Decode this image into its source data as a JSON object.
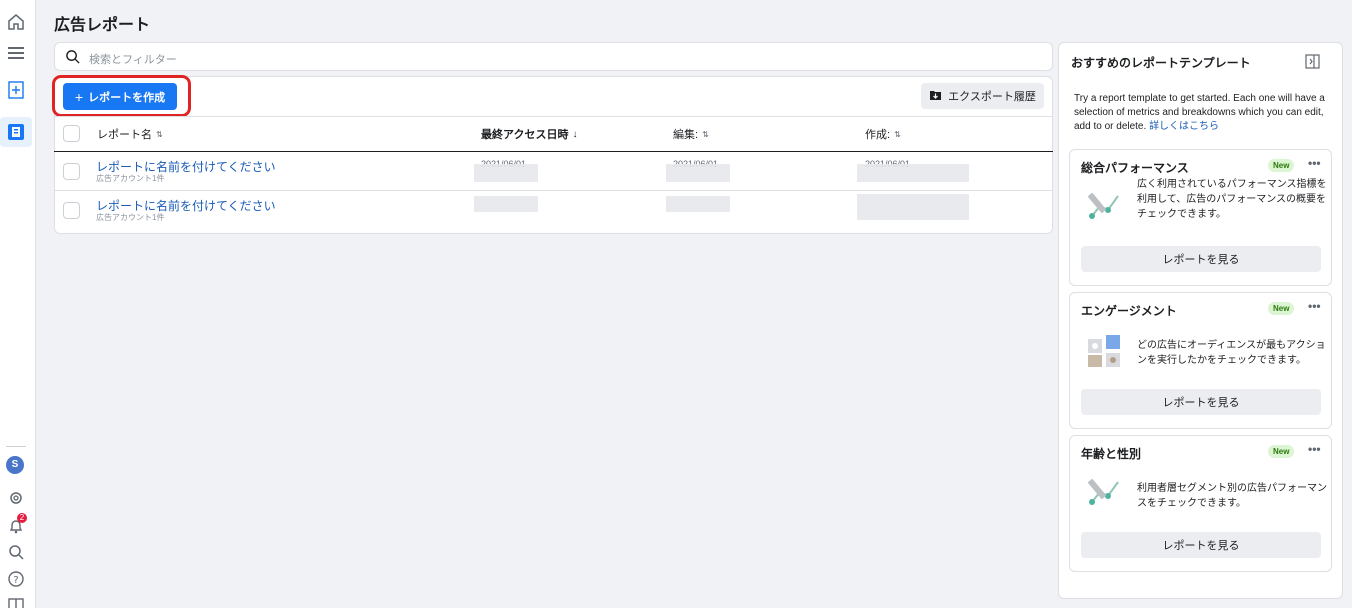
{
  "page": {
    "title": "広告レポート"
  },
  "sidebar": {
    "notification_count": "2",
    "account_initial": "S"
  },
  "search": {
    "placeholder": "検索とフィルター"
  },
  "toolbar": {
    "create_label": "レポートを作成",
    "export_label": "エクスポート履歴"
  },
  "table": {
    "columns": [
      {
        "label": "レポート名"
      },
      {
        "label": "最終アクセス日時"
      },
      {
        "label": "編集:"
      },
      {
        "label": "作成:"
      }
    ],
    "rows": [
      {
        "name": "レポートに名前を付けてください",
        "sub": "広告アカウント1件",
        "accessed": "2021/06/01",
        "edited": "2021/06/01",
        "created": "2021/06/01"
      },
      {
        "name": "レポートに名前を付けてください",
        "sub": "広告アカウント1件",
        "accessed": "",
        "edited": "",
        "created": ""
      }
    ]
  },
  "panel": {
    "title": "おすすめのレポートテンプレート",
    "description": "Try a report template to get started. Each one will have a selection of metrics and breakdowns which you can edit, add to or delete.",
    "link": "詳しくはこちら",
    "templates": [
      {
        "title": "総合パフォーマンス",
        "badge": "New",
        "more": "•••",
        "text": "広く利用されているパフォーマンス指標を利用して、広告のパフォーマンスの概要をチェックできます。",
        "button": "レポートを見る"
      },
      {
        "title": "エンゲージメント",
        "badge": "New",
        "more": "•••",
        "text": "どの広告にオーディエンスが最もアクションを実行したかをチェックできます。",
        "button": "レポートを見る"
      },
      {
        "title": "年齢と性別",
        "badge": "New",
        "more": "•••",
        "text": "利用者層セグメント別の広告パフォーマンスをチェックできます。",
        "button": "レポートを見る"
      }
    ]
  },
  "colors": {
    "accent": "#1877f2",
    "highlight": "#e02424",
    "link": "#1a5bb8",
    "new_badge_bg": "#dcf5d3"
  }
}
